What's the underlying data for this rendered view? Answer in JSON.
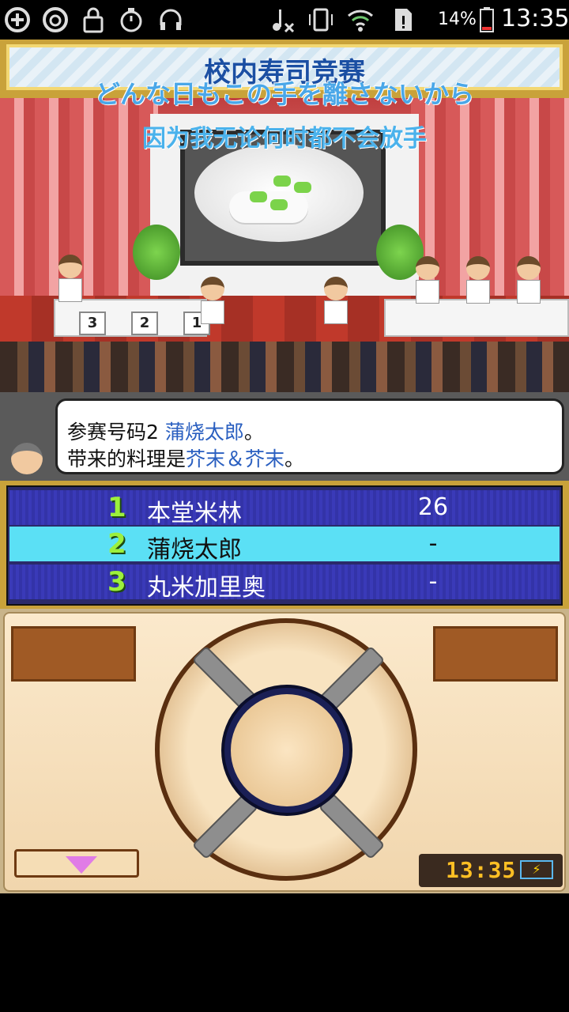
{
  "status_bar": {
    "battery_percent": "14%",
    "time": "13:35",
    "icons": [
      "add-circle-icon",
      "netease-music-icon",
      "lock-icon",
      "stopwatch-icon",
      "headphones-icon",
      "music-mute-icon",
      "vibrate-icon",
      "wifi-icon",
      "sim-alert-icon",
      "battery-icon"
    ]
  },
  "title_bar": {
    "title": "校内寿司竞赛",
    "subtitle_jp": "どんな日もこの手を離さないから",
    "subtitle_cn": "因为我无论何时都不会放手"
  },
  "stage": {
    "podium_numbers": [
      "3",
      "2",
      "1"
    ]
  },
  "dialog": {
    "line1_prefix": "参赛号码2 ",
    "line1_name": "蒲烧太郎",
    "line1_suffix": "。",
    "line2_prefix": "带来的料理是",
    "line2_dish": "芥末＆芥末",
    "line2_suffix": "。"
  },
  "ranking": {
    "rows": [
      {
        "rank": "1",
        "name": "本堂米林",
        "score": "26",
        "highlighted": false
      },
      {
        "rank": "2",
        "name": "蒲烧太郎",
        "score": "-",
        "highlighted": true
      },
      {
        "rank": "3",
        "name": "丸米加里奥",
        "score": "-",
        "highlighted": false
      }
    ]
  },
  "controls": {
    "clock": "13:35",
    "battery_icon": "battery-charging-icon",
    "down_button_icon": "triangle-down-icon"
  },
  "colors": {
    "rank_dark": "#3a3ab8",
    "rank_highlight": "#5be0f5",
    "rank_number": "#9cf03c",
    "dialog_highlight": "#2a5fc0"
  }
}
